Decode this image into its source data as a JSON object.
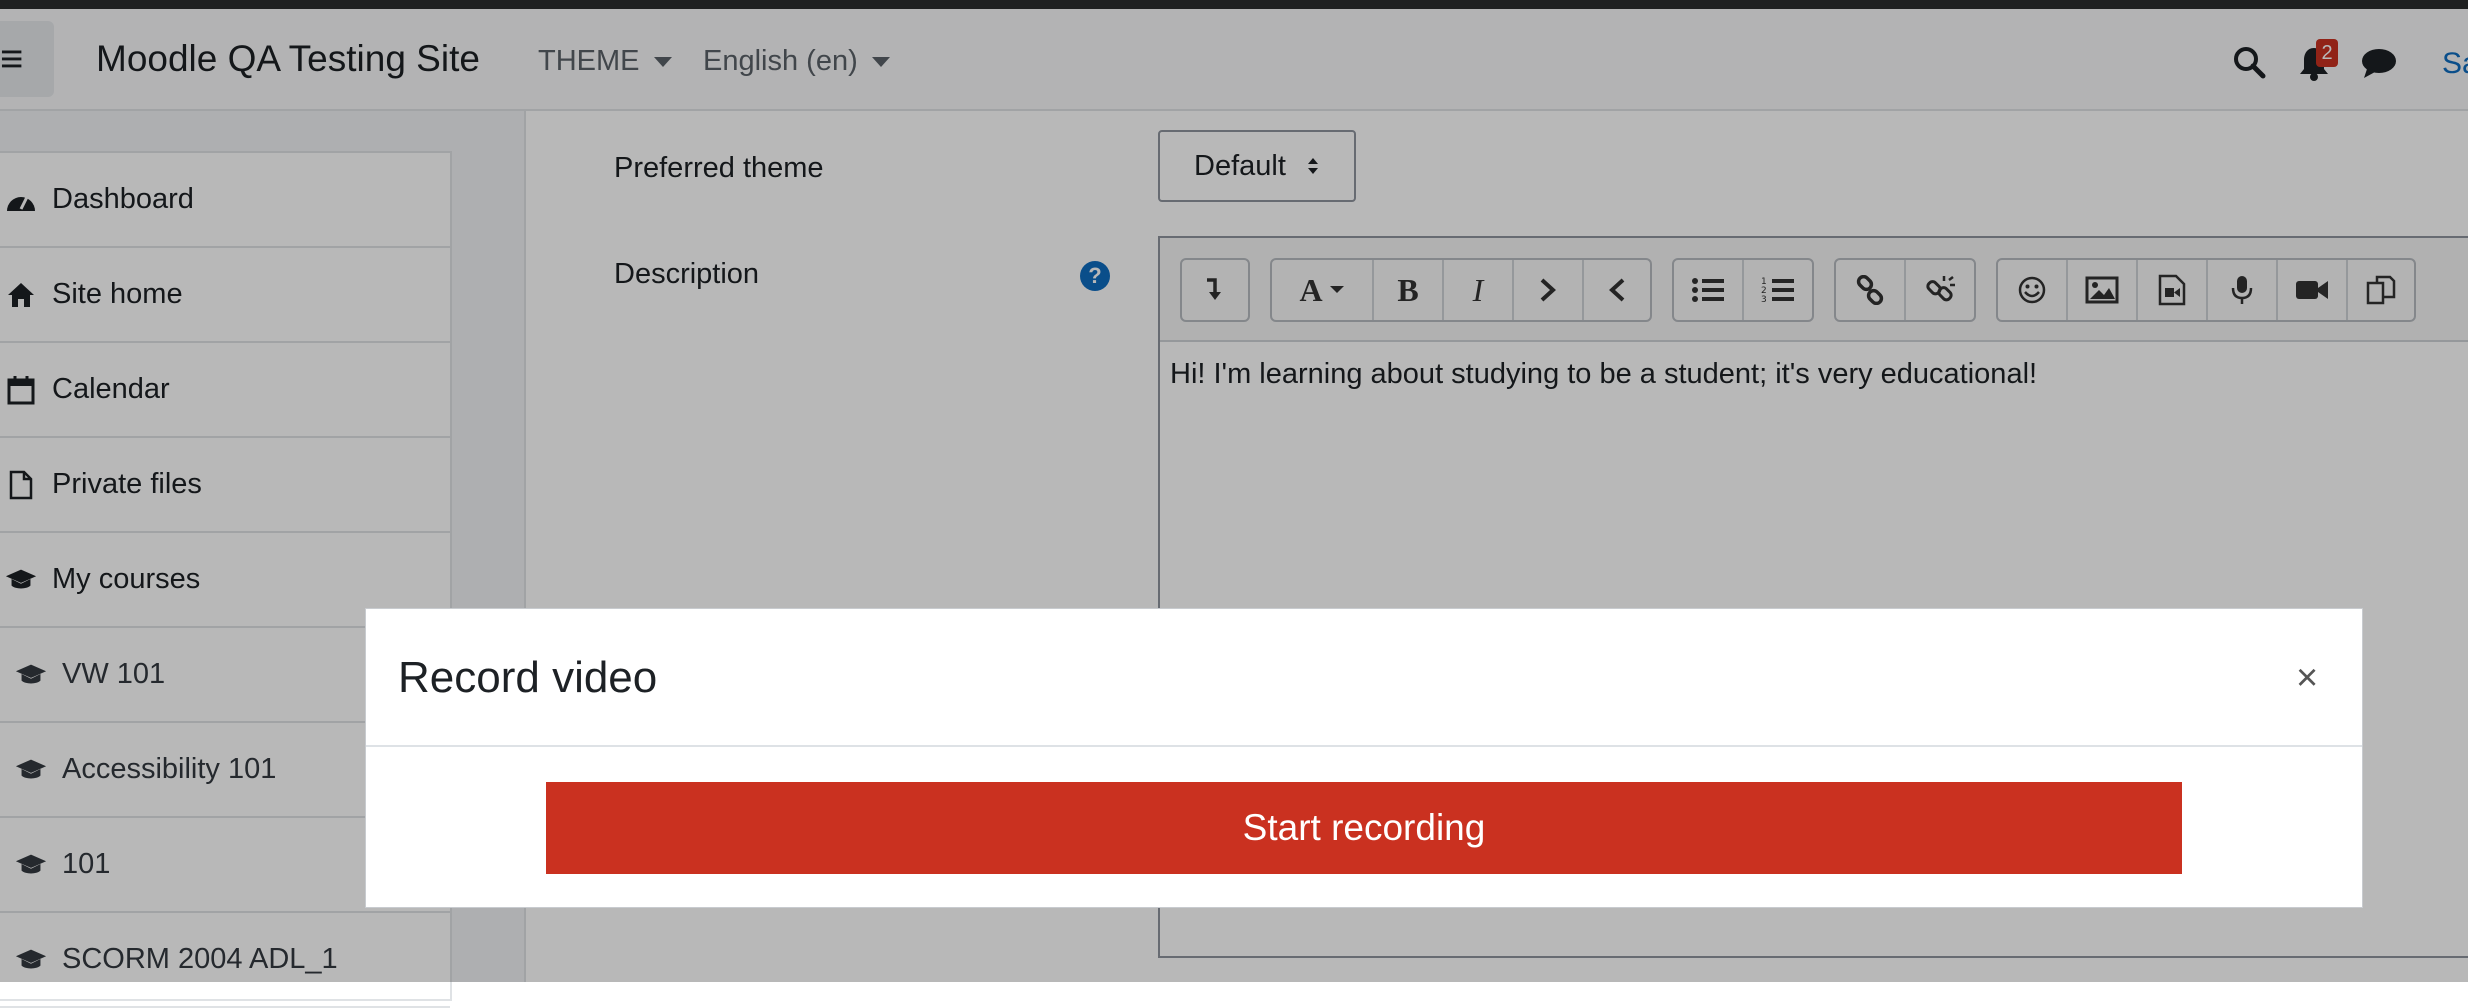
{
  "navbar": {
    "site_name": "Moodle QA Testing Site",
    "theme_menu": "THEME",
    "language_menu": "English (en)",
    "notification_count": "2",
    "user_link": "Sa"
  },
  "sidebar": {
    "items": [
      {
        "label": "Dashboard",
        "icon": "dashboard-icon"
      },
      {
        "label": "Site home",
        "icon": "home-icon"
      },
      {
        "label": "Calendar",
        "icon": "calendar-icon"
      },
      {
        "label": "Private files",
        "icon": "file-icon"
      },
      {
        "label": "My courses",
        "icon": "graduation-cap-icon"
      },
      {
        "label": "VW 101",
        "icon": "graduation-cap-icon"
      },
      {
        "label": "Accessibility 101",
        "icon": "graduation-cap-icon"
      },
      {
        "label": "101",
        "icon": "graduation-cap-icon"
      },
      {
        "label": "SCORM 2004 ADL_1",
        "icon": "graduation-cap-icon"
      }
    ]
  },
  "form": {
    "preferred_theme_label": "Preferred theme",
    "preferred_theme_value": "Default",
    "description_label": "Description",
    "description_text": "Hi! I'm learning about studying to be a student; it's very educational!"
  },
  "modal": {
    "title": "Record video",
    "close_glyph": "×",
    "start_button": "Start recording"
  },
  "colors": {
    "accent": "#0f6cbf",
    "danger": "#ca3120"
  }
}
